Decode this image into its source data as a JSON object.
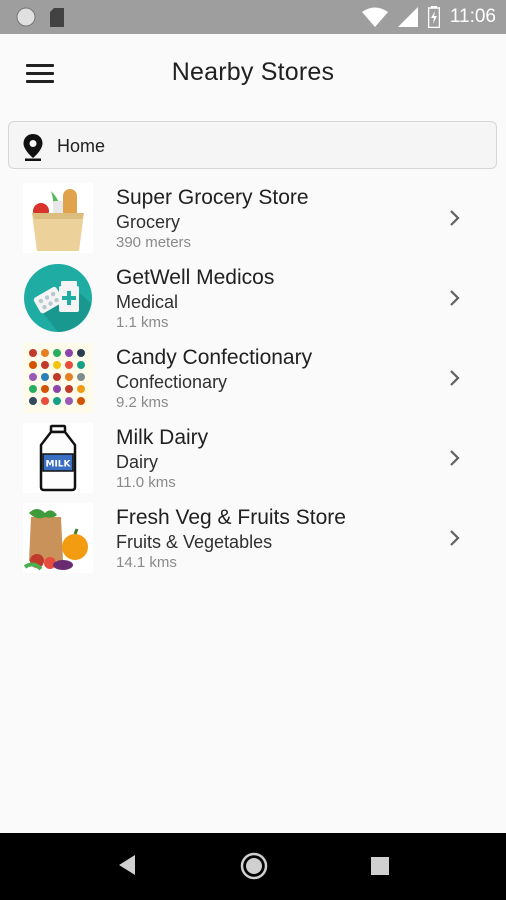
{
  "status_bar": {
    "time": "11:06"
  },
  "app_bar": {
    "title": "Nearby Stores"
  },
  "location": {
    "value": "Home"
  },
  "stores": [
    {
      "name": "Super Grocery Store",
      "category": "Grocery",
      "distance": "390 meters",
      "icon": "grocery-bag-icon"
    },
    {
      "name": "GetWell Medicos",
      "category": "Medical",
      "distance": "1.1 kms",
      "icon": "medicine-icon"
    },
    {
      "name": "Candy Confectionary",
      "category": "Confectionary",
      "distance": "9.2 kms",
      "icon": "candy-icon"
    },
    {
      "name": "Milk Dairy",
      "category": "Dairy",
      "distance": "11.0 kms",
      "icon": "milk-bottle-icon",
      "icon_label": "MILK"
    },
    {
      "name": "Fresh Veg & Fruits Store",
      "category": "Fruits & Vegetables",
      "distance": "14.1 kms",
      "icon": "vegetables-icon"
    }
  ],
  "colors": {
    "accent_teal": "#1fada3",
    "milk_blue": "#3a6fc4"
  }
}
